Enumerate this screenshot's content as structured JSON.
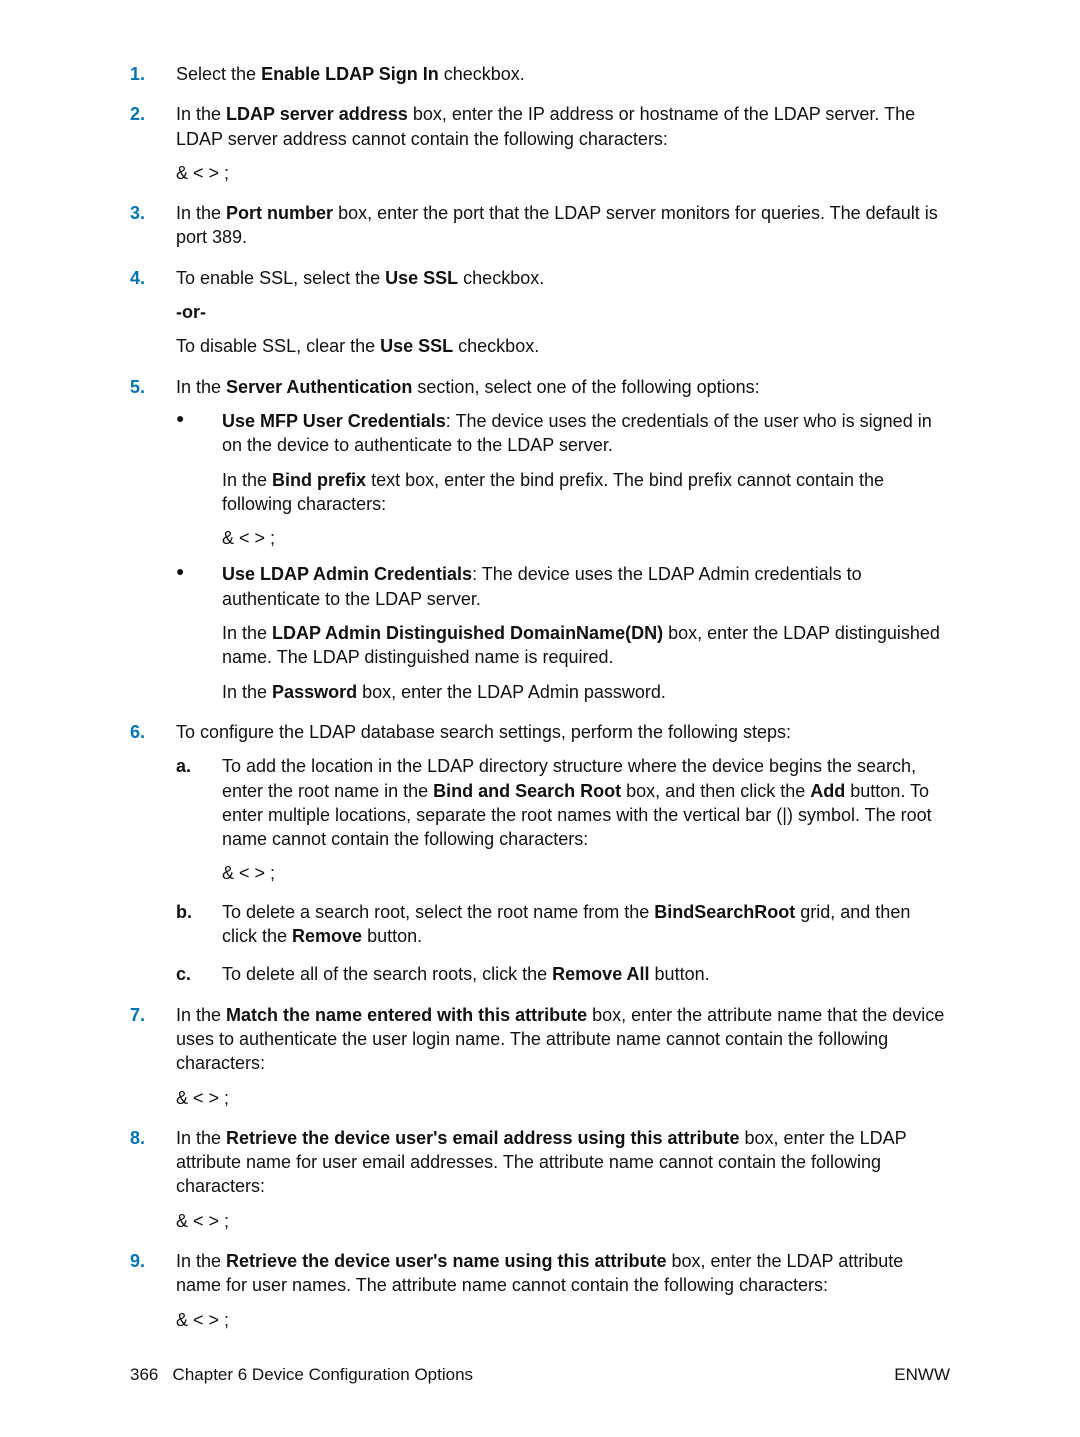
{
  "steps": {
    "s1": {
      "num": "1.",
      "t1": "Select the ",
      "b1": "Enable LDAP Sign In",
      "t2": " checkbox."
    },
    "s2": {
      "num": "2.",
      "t1": "In the ",
      "b1": "LDAP server address",
      "t2": " box, enter the IP address or hostname of the LDAP server. The LDAP server address cannot contain the following characters:",
      "chars": "& < > ;"
    },
    "s3": {
      "num": "3.",
      "t1": "In the ",
      "b1": "Port number",
      "t2": " box, enter the port that the LDAP server monitors for queries. The default is port 389."
    },
    "s4": {
      "num": "4.",
      "t1": "To enable SSL, select the ",
      "b1": "Use SSL",
      "t2": " checkbox.",
      "or": "-or-",
      "t3": "To disable SSL, clear the ",
      "b2": "Use SSL",
      "t4": " checkbox."
    },
    "s5": {
      "num": "5.",
      "t1": "In the ",
      "b1": "Server Authentication",
      "t2": " section, select one of the following options:",
      "bullet1": {
        "b1": "Use MFP User Credentials",
        "t1": ": The device uses the credentials of the user who is signed in on the device to authenticate to the LDAP server.",
        "inner_t1": "In the ",
        "inner_b1": "Bind prefix",
        "inner_t2": " text box, enter the bind prefix. The bind prefix cannot contain the following characters:",
        "chars": "& < > ;"
      },
      "bullet2": {
        "b1": "Use LDAP Admin Credentials",
        "t1": ": The device uses the LDAP Admin credentials to authenticate to the LDAP server.",
        "inner_t1": "In the ",
        "inner_b1": "LDAP Admin Distinguished DomainName(DN)",
        "inner_t2": " box, enter the LDAP distinguished name. The LDAP distinguished name is required.",
        "inner_t3": "In the ",
        "inner_b2": "Password",
        "inner_t4": " box, enter the LDAP Admin password."
      }
    },
    "s6": {
      "num": "6.",
      "t1": "To configure the LDAP database search settings, perform the following steps:",
      "a": {
        "alph": "a.",
        "t1": "To add the location in the LDAP directory structure where the device begins the search, enter the root name in the ",
        "b1": "Bind and Search Root",
        "t2": " box, and then click the ",
        "b2": "Add",
        "t3": " button. To enter multiple locations, separate the root names with the vertical bar (|) symbol. The root name cannot contain the following characters:",
        "chars": "& < > ;"
      },
      "b": {
        "alph": "b.",
        "t1": "To delete a search root, select the root name from the ",
        "b1": "BindSearchRoot",
        "t2": " grid, and then click the ",
        "b2": "Remove",
        "t3": " button."
      },
      "c": {
        "alph": "c.",
        "t1": "To delete all of the search roots, click the ",
        "b1": "Remove All",
        "t2": " button."
      }
    },
    "s7": {
      "num": "7.",
      "t1": "In the ",
      "b1": "Match the name entered with this attribute",
      "t2": " box, enter the attribute name that the device uses to authenticate the user login name. The attribute name cannot contain the following characters:",
      "chars": "& < > ;"
    },
    "s8": {
      "num": "8.",
      "t1": "In the ",
      "b1": "Retrieve the device user's email address using this attribute",
      "t2": " box, enter the LDAP attribute name for user email addresses. The attribute name cannot contain the following characters:",
      "chars": "& < > ;"
    },
    "s9": {
      "num": "9.",
      "t1": "In the ",
      "b1": "Retrieve the device user's name using this attribute",
      "t2": " box, enter the LDAP attribute name for user names. The attribute name cannot contain the following characters:",
      "chars": "& < > ;"
    }
  },
  "footer": {
    "left_page": "366",
    "left_chapter": "Chapter 6   Device Configuration Options",
    "right": "ENWW"
  }
}
